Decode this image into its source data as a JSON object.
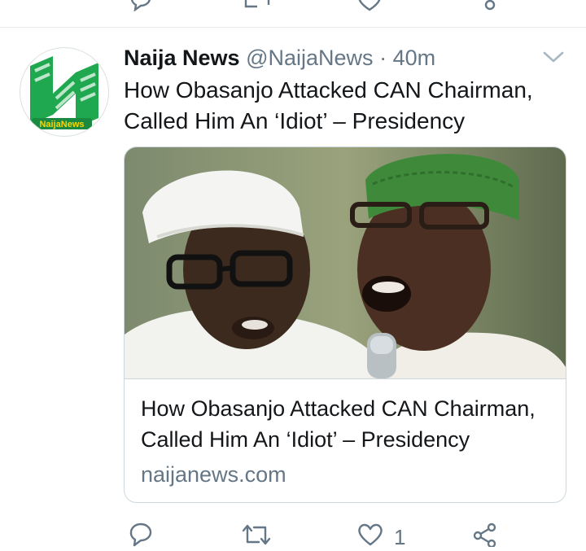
{
  "tweet": {
    "author_name": "Naija News",
    "author_handle": "@NaijaNews",
    "separator": "·",
    "timestamp": "40m",
    "text": "How Obasanjo Attacked CAN Chairman, Called Him An ‘Idiot’ – Presidency",
    "avatar_logo_text": "NaijaNews",
    "card": {
      "title": "How Obasanjo Attacked CAN Chairman, Called Him An ‘Idiot’ – Presidency",
      "domain": "naijanews.com"
    },
    "actions": {
      "reply_count": "",
      "retweet_count": "",
      "like_count": "1"
    }
  },
  "colors": {
    "brand_green": "#1fa84f",
    "text_primary": "#14171a",
    "text_secondary": "#657786",
    "border": "#ccd6dd"
  },
  "icons": [
    "reply-icon",
    "retweet-icon",
    "like-icon",
    "share-icon",
    "chevron-down-icon"
  ]
}
